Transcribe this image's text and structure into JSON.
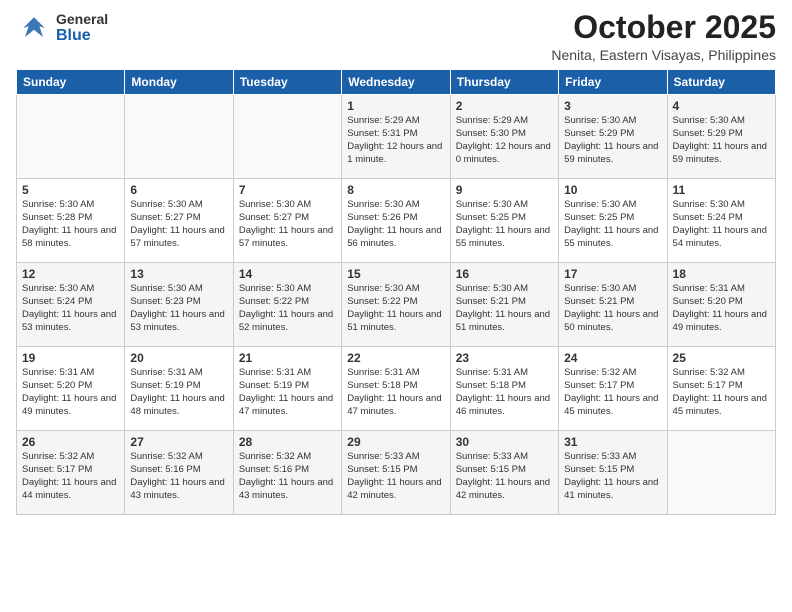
{
  "header": {
    "logo_general": "General",
    "logo_blue": "Blue",
    "month_title": "October 2025",
    "location": "Nenita, Eastern Visayas, Philippines"
  },
  "weekdays": [
    "Sunday",
    "Monday",
    "Tuesday",
    "Wednesday",
    "Thursday",
    "Friday",
    "Saturday"
  ],
  "weeks": [
    [
      {
        "day": "",
        "sunrise": "",
        "sunset": "",
        "daylight": ""
      },
      {
        "day": "",
        "sunrise": "",
        "sunset": "",
        "daylight": ""
      },
      {
        "day": "",
        "sunrise": "",
        "sunset": "",
        "daylight": ""
      },
      {
        "day": "1",
        "sunrise": "Sunrise: 5:29 AM",
        "sunset": "Sunset: 5:31 PM",
        "daylight": "Daylight: 12 hours and 1 minute."
      },
      {
        "day": "2",
        "sunrise": "Sunrise: 5:29 AM",
        "sunset": "Sunset: 5:30 PM",
        "daylight": "Daylight: 12 hours and 0 minutes."
      },
      {
        "day": "3",
        "sunrise": "Sunrise: 5:30 AM",
        "sunset": "Sunset: 5:29 PM",
        "daylight": "Daylight: 11 hours and 59 minutes."
      },
      {
        "day": "4",
        "sunrise": "Sunrise: 5:30 AM",
        "sunset": "Sunset: 5:29 PM",
        "daylight": "Daylight: 11 hours and 59 minutes."
      }
    ],
    [
      {
        "day": "5",
        "sunrise": "Sunrise: 5:30 AM",
        "sunset": "Sunset: 5:28 PM",
        "daylight": "Daylight: 11 hours and 58 minutes."
      },
      {
        "day": "6",
        "sunrise": "Sunrise: 5:30 AM",
        "sunset": "Sunset: 5:27 PM",
        "daylight": "Daylight: 11 hours and 57 minutes."
      },
      {
        "day": "7",
        "sunrise": "Sunrise: 5:30 AM",
        "sunset": "Sunset: 5:27 PM",
        "daylight": "Daylight: 11 hours and 57 minutes."
      },
      {
        "day": "8",
        "sunrise": "Sunrise: 5:30 AM",
        "sunset": "Sunset: 5:26 PM",
        "daylight": "Daylight: 11 hours and 56 minutes."
      },
      {
        "day": "9",
        "sunrise": "Sunrise: 5:30 AM",
        "sunset": "Sunset: 5:25 PM",
        "daylight": "Daylight: 11 hours and 55 minutes."
      },
      {
        "day": "10",
        "sunrise": "Sunrise: 5:30 AM",
        "sunset": "Sunset: 5:25 PM",
        "daylight": "Daylight: 11 hours and 55 minutes."
      },
      {
        "day": "11",
        "sunrise": "Sunrise: 5:30 AM",
        "sunset": "Sunset: 5:24 PM",
        "daylight": "Daylight: 11 hours and 54 minutes."
      }
    ],
    [
      {
        "day": "12",
        "sunrise": "Sunrise: 5:30 AM",
        "sunset": "Sunset: 5:24 PM",
        "daylight": "Daylight: 11 hours and 53 minutes."
      },
      {
        "day": "13",
        "sunrise": "Sunrise: 5:30 AM",
        "sunset": "Sunset: 5:23 PM",
        "daylight": "Daylight: 11 hours and 53 minutes."
      },
      {
        "day": "14",
        "sunrise": "Sunrise: 5:30 AM",
        "sunset": "Sunset: 5:22 PM",
        "daylight": "Daylight: 11 hours and 52 minutes."
      },
      {
        "day": "15",
        "sunrise": "Sunrise: 5:30 AM",
        "sunset": "Sunset: 5:22 PM",
        "daylight": "Daylight: 11 hours and 51 minutes."
      },
      {
        "day": "16",
        "sunrise": "Sunrise: 5:30 AM",
        "sunset": "Sunset: 5:21 PM",
        "daylight": "Daylight: 11 hours and 51 minutes."
      },
      {
        "day": "17",
        "sunrise": "Sunrise: 5:30 AM",
        "sunset": "Sunset: 5:21 PM",
        "daylight": "Daylight: 11 hours and 50 minutes."
      },
      {
        "day": "18",
        "sunrise": "Sunrise: 5:31 AM",
        "sunset": "Sunset: 5:20 PM",
        "daylight": "Daylight: 11 hours and 49 minutes."
      }
    ],
    [
      {
        "day": "19",
        "sunrise": "Sunrise: 5:31 AM",
        "sunset": "Sunset: 5:20 PM",
        "daylight": "Daylight: 11 hours and 49 minutes."
      },
      {
        "day": "20",
        "sunrise": "Sunrise: 5:31 AM",
        "sunset": "Sunset: 5:19 PM",
        "daylight": "Daylight: 11 hours and 48 minutes."
      },
      {
        "day": "21",
        "sunrise": "Sunrise: 5:31 AM",
        "sunset": "Sunset: 5:19 PM",
        "daylight": "Daylight: 11 hours and 47 minutes."
      },
      {
        "day": "22",
        "sunrise": "Sunrise: 5:31 AM",
        "sunset": "Sunset: 5:18 PM",
        "daylight": "Daylight: 11 hours and 47 minutes."
      },
      {
        "day": "23",
        "sunrise": "Sunrise: 5:31 AM",
        "sunset": "Sunset: 5:18 PM",
        "daylight": "Daylight: 11 hours and 46 minutes."
      },
      {
        "day": "24",
        "sunrise": "Sunrise: 5:32 AM",
        "sunset": "Sunset: 5:17 PM",
        "daylight": "Daylight: 11 hours and 45 minutes."
      },
      {
        "day": "25",
        "sunrise": "Sunrise: 5:32 AM",
        "sunset": "Sunset: 5:17 PM",
        "daylight": "Daylight: 11 hours and 45 minutes."
      }
    ],
    [
      {
        "day": "26",
        "sunrise": "Sunrise: 5:32 AM",
        "sunset": "Sunset: 5:17 PM",
        "daylight": "Daylight: 11 hours and 44 minutes."
      },
      {
        "day": "27",
        "sunrise": "Sunrise: 5:32 AM",
        "sunset": "Sunset: 5:16 PM",
        "daylight": "Daylight: 11 hours and 43 minutes."
      },
      {
        "day": "28",
        "sunrise": "Sunrise: 5:32 AM",
        "sunset": "Sunset: 5:16 PM",
        "daylight": "Daylight: 11 hours and 43 minutes."
      },
      {
        "day": "29",
        "sunrise": "Sunrise: 5:33 AM",
        "sunset": "Sunset: 5:15 PM",
        "daylight": "Daylight: 11 hours and 42 minutes."
      },
      {
        "day": "30",
        "sunrise": "Sunrise: 5:33 AM",
        "sunset": "Sunset: 5:15 PM",
        "daylight": "Daylight: 11 hours and 42 minutes."
      },
      {
        "day": "31",
        "sunrise": "Sunrise: 5:33 AM",
        "sunset": "Sunset: 5:15 PM",
        "daylight": "Daylight: 11 hours and 41 minutes."
      },
      {
        "day": "",
        "sunrise": "",
        "sunset": "",
        "daylight": ""
      }
    ]
  ]
}
